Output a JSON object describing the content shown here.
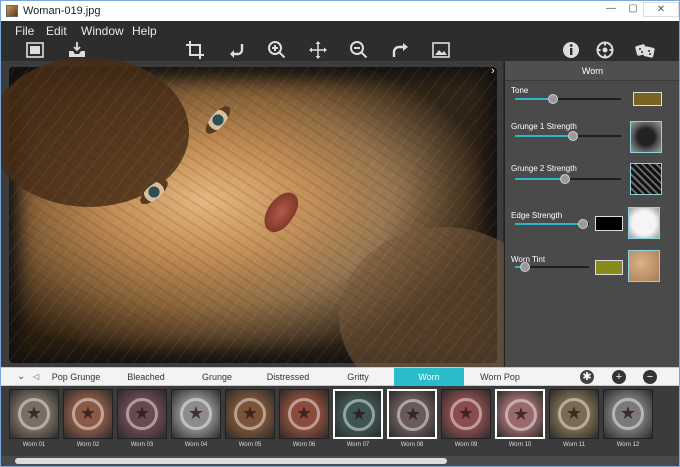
{
  "window": {
    "title": "Woman-019.jpg",
    "minimize": "—",
    "maximize": "▢",
    "close": "✕"
  },
  "menu": [
    "File",
    "Edit",
    "Window",
    "Help"
  ],
  "toolbar": {
    "left": [
      "image-icon",
      "save-icon"
    ],
    "center": [
      "crop-icon",
      "undo-icon",
      "zoom-in-icon",
      "pan-icon",
      "zoom-out-icon",
      "redo-icon",
      "compare-icon"
    ],
    "right": [
      "info-icon",
      "settings-icon",
      "dice-icon"
    ]
  },
  "panel": {
    "title": "Worn",
    "controls": [
      {
        "label": "Tone",
        "value": 0.36,
        "swatch": "#7a6320"
      },
      {
        "label": "Grunge 1 Strength",
        "value": 0.55,
        "texture": "dark-grunge"
      },
      {
        "label": "Grunge 2 Strength",
        "value": 0.47,
        "texture": "dark-crackle"
      },
      {
        "label": "Edge Strength",
        "value": 0.92,
        "swatch": "#000000",
        "texture": "light-edge"
      },
      {
        "label": "Worn Tint",
        "value": 0.14,
        "swatch": "#8a8a1a",
        "texture": "paper"
      }
    ]
  },
  "tabs": {
    "items": [
      "Pop Grunge",
      "Bleached",
      "Grunge",
      "Distressed",
      "Gritty",
      "Worn",
      "Worn Pop"
    ],
    "active": "Worn"
  },
  "presets": [
    {
      "label": "Worn 01",
      "color": "#7a6e62"
    },
    {
      "label": "Worn 02",
      "color": "#8a5a46"
    },
    {
      "label": "Worn 03",
      "color": "#6a4a50"
    },
    {
      "label": "Worn 04",
      "color": "#8c8c8c"
    },
    {
      "label": "Worn 05",
      "color": "#7a5438"
    },
    {
      "label": "Worn 06",
      "color": "#8a4c3c"
    },
    {
      "label": "Worn 07",
      "color": "#3e5652",
      "selected": true
    },
    {
      "label": "Worn 08",
      "color": "#6a5a5a",
      "selected": true
    },
    {
      "label": "Worn 09",
      "color": "#8a4c4c"
    },
    {
      "label": "Worn 10",
      "color": "#9a6a6a",
      "selected": true
    },
    {
      "label": "Worn 11",
      "color": "#7a6a52"
    },
    {
      "label": "Worn 12",
      "color": "#7a7a7a"
    }
  ]
}
